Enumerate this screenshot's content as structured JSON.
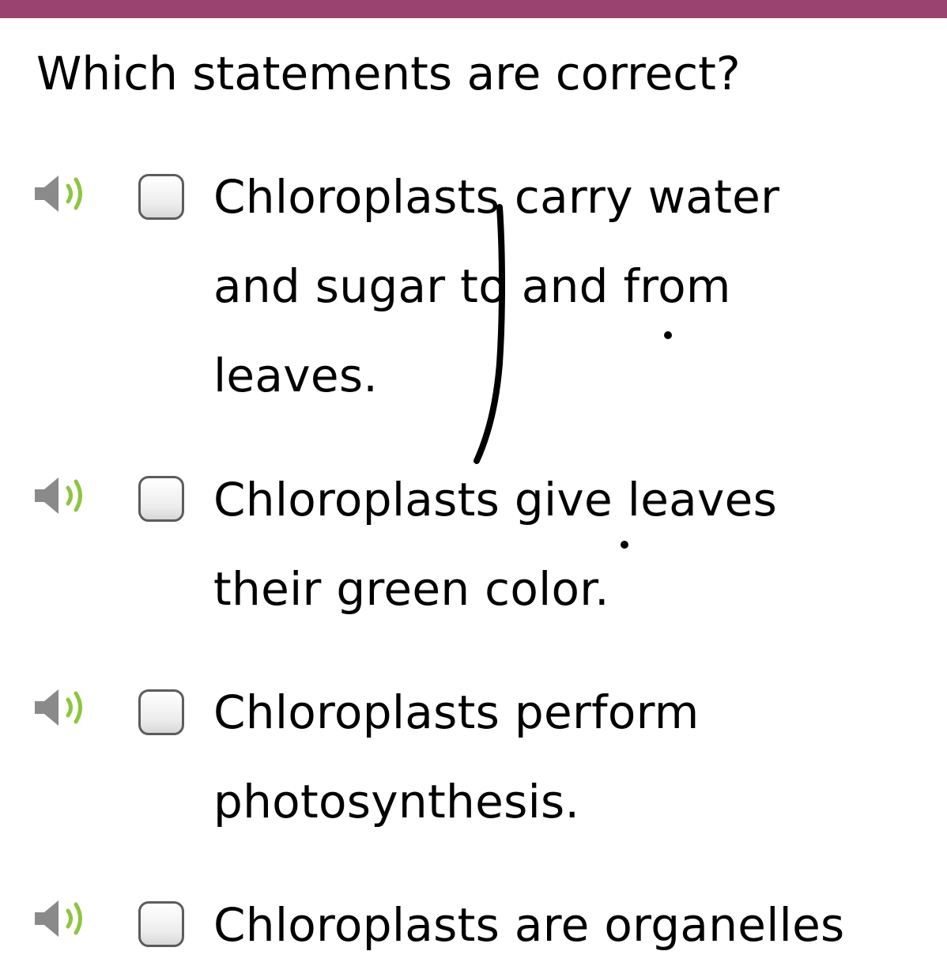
{
  "header": {
    "accent_color": "#9a4370"
  },
  "question": {
    "text": "Which statements are correct?"
  },
  "options": [
    {
      "text": "Chloroplasts carry water\nand sugar to and from\nleaves.",
      "checked": false,
      "speaker_icon": "speaker-icon"
    },
    {
      "text": "Chloroplasts give leaves\ntheir green color.",
      "checked": false,
      "speaker_icon": "speaker-icon"
    },
    {
      "text": "Chloroplasts perform\nphotosynthesis.",
      "checked": false,
      "speaker_icon": "speaker-icon"
    },
    {
      "text": "Chloroplasts are organelles",
      "checked": false,
      "speaker_icon": "speaker-icon"
    }
  ],
  "colors": {
    "speaker_gray": "#8a8a8a",
    "speaker_waves": "#8cc63f",
    "checkbox_border": "#5c5c5c",
    "ink": "#000000"
  }
}
